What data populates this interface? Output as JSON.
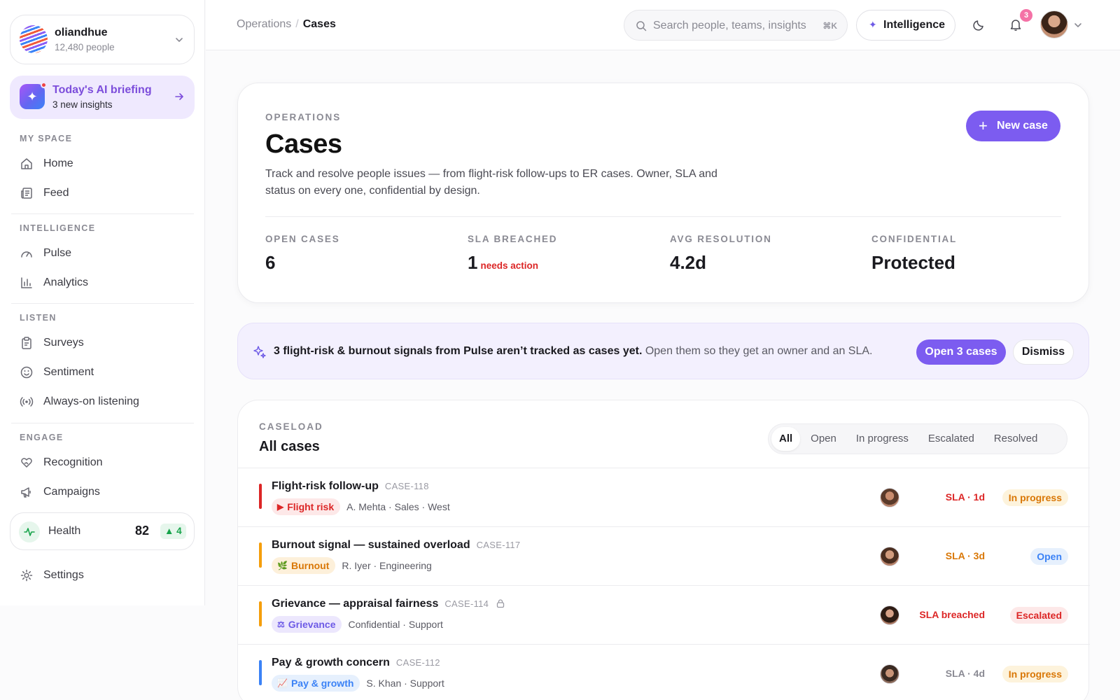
{
  "org": {
    "name": "oliandhue",
    "people": "12,480 people"
  },
  "briefing": {
    "title": "Today's AI briefing",
    "subtitle": "3 new insights"
  },
  "nav": {
    "my_space": {
      "label": "MY SPACE",
      "items": [
        {
          "label": "Home",
          "icon": "home-icon"
        },
        {
          "label": "Feed",
          "icon": "feed-icon"
        }
      ]
    },
    "intelligence": {
      "label": "INTELLIGENCE",
      "items": [
        {
          "label": "Pulse",
          "icon": "gauge-icon"
        },
        {
          "label": "Analytics",
          "icon": "bar-chart-icon"
        }
      ]
    },
    "listen": {
      "label": "LISTEN",
      "items": [
        {
          "label": "Surveys",
          "icon": "clipboard-icon"
        },
        {
          "label": "Sentiment",
          "icon": "smiley-icon"
        },
        {
          "label": "Always-on listening",
          "icon": "broadcast-icon"
        }
      ]
    },
    "engage": {
      "label": "ENGAGE",
      "items": [
        {
          "label": "Recognition",
          "icon": "heart-hand-icon"
        },
        {
          "label": "Campaigns",
          "icon": "megaphone-icon"
        }
      ]
    }
  },
  "health": {
    "label": "Health",
    "score": "82",
    "delta": "▲ 4"
  },
  "settings": {
    "label": "Settings"
  },
  "topbar": {
    "breadcrumb": [
      "Operations",
      "Cases"
    ],
    "search_placeholder": "Search people, teams, insights",
    "search_shortcut": "⌘K",
    "intelligence_label": "Intelligence",
    "notifications_count": "3"
  },
  "hero": {
    "eyebrow": "OPERATIONS",
    "title": "Cases",
    "description": "Track and resolve people issues — from flight-risk follow-ups to ER cases. Owner, SLA and status on every one, confidential by design.",
    "new_case_label": "New case",
    "stats": [
      {
        "label": "OPEN CASES",
        "value": "6",
        "note": ""
      },
      {
        "label": "SLA BREACHED",
        "value": "1",
        "note": "needs action"
      },
      {
        "label": "AVG RESOLUTION",
        "value": "4.2d",
        "note": ""
      },
      {
        "label": "CONFIDENTIAL",
        "value": "Protected",
        "note": ""
      }
    ]
  },
  "banner": {
    "bold": "3 flight-risk & burnout signals from Pulse aren’t tracked as cases yet.",
    "text": " Open them so they get an owner and an SLA.",
    "primary": "Open 3 cases",
    "secondary": "Dismiss"
  },
  "caseload": {
    "eyebrow": "CASELOAD",
    "title": "All cases",
    "tabs": [
      "All",
      "Open",
      "In progress",
      "Escalated",
      "Resolved"
    ],
    "active_tab": "All",
    "rows": [
      {
        "title": "Flight-risk follow-up",
        "id": "CASE-118",
        "tag": "Flight risk",
        "tag_icon": "▶",
        "meta": "A. Mehta · Sales · West",
        "sla": "SLA · 1d",
        "status": "In progress",
        "accent": "#dc2626",
        "confidential": false
      },
      {
        "title": "Burnout signal — sustained overload",
        "id": "CASE-117",
        "tag": "Burnout",
        "tag_icon": "🌿",
        "meta": "R. Iyer · Engineering",
        "sla": "SLA · 3d",
        "status": "Open",
        "accent": "#f59e0b",
        "confidential": false
      },
      {
        "title": "Grievance — appraisal fairness",
        "id": "CASE-114",
        "tag": "Grievance",
        "tag_icon": "⚖",
        "meta": "Confidential · Support",
        "sla": "SLA breached",
        "status": "Escalated",
        "accent": "#f59e0b",
        "confidential": true
      },
      {
        "title": "Pay & growth concern",
        "id": "CASE-112",
        "tag": "Pay & growth",
        "tag_icon": "📈",
        "meta": "S. Khan · Support",
        "sla": "SLA · 4d",
        "status": "In progress",
        "accent": "#3b82f6",
        "confidential": false
      }
    ]
  },
  "colors": {
    "accent": "#7c5cf0",
    "danger": "#dc2626",
    "warning": "#d97706",
    "info": "#3b82f6",
    "success": "#16a34a"
  }
}
